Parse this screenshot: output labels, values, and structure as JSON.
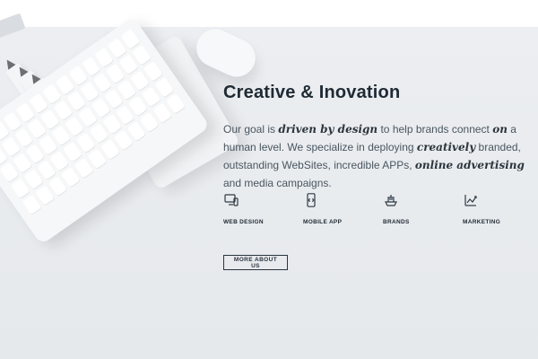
{
  "hero": {
    "headline": "Creative & Inovation",
    "paragraph": {
      "p1": "Our goal is ",
      "em1": "driven by design",
      "p2": " to help brands connect ",
      "em2": "on",
      "p3": " a human level. We specialize in deploying ",
      "em3": "creatively",
      "p4": " branded, outstanding WebSites, incredible APPs, ",
      "em4": "online advertising",
      "p5": " and media campaigns."
    }
  },
  "services": [
    {
      "label": "WEB DESIGN",
      "icon": "monitor-phone-icon"
    },
    {
      "label": "MOBILE APP",
      "icon": "mobile-code-icon"
    },
    {
      "label": "BRANDS",
      "icon": "ship-icon"
    },
    {
      "label": "MARKETING",
      "icon": "chart-growth-icon"
    }
  ],
  "cta": {
    "label": "MORE ABOUT US"
  },
  "colors": {
    "background": "#e9ecef",
    "text_dark": "#1f2a33",
    "text_body": "#4a5660",
    "button_border": "#2b3440"
  }
}
